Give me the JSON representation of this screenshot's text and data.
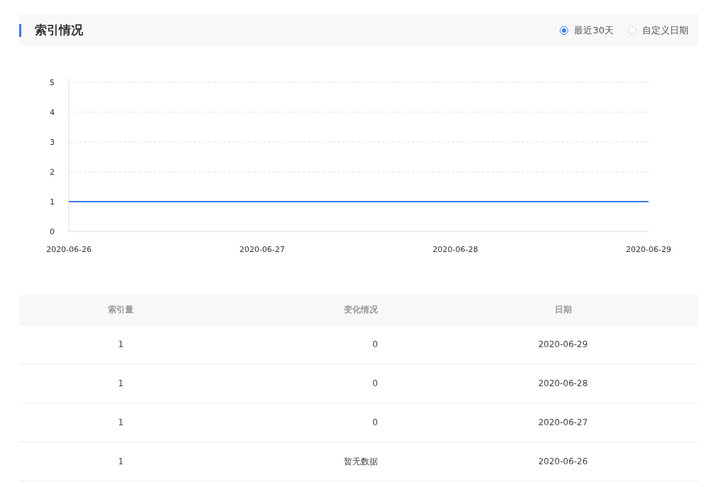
{
  "header": {
    "title": "索引情况",
    "range_options": [
      {
        "label": "最近30天",
        "selected": true
      },
      {
        "label": "自定义日期",
        "selected": false
      }
    ]
  },
  "chart_data": {
    "type": "line",
    "categories": [
      "2020-06-26",
      "2020-06-27",
      "2020-06-28",
      "2020-06-29"
    ],
    "ylim": [
      0,
      5
    ],
    "yticks": [
      0,
      1,
      2,
      3,
      4,
      5
    ],
    "grid": true,
    "series": [
      {
        "color": "#3a7bec",
        "values": [
          1,
          1,
          1,
          1
        ]
      }
    ]
  },
  "table": {
    "columns": [
      "索引量",
      "变化情况",
      "日期"
    ],
    "rows": [
      {
        "cells": [
          "1",
          "0",
          "2020-06-29"
        ]
      },
      {
        "cells": [
          "1",
          "0",
          "2020-06-28"
        ]
      },
      {
        "cells": [
          "1",
          "0",
          "2020-06-27"
        ]
      },
      {
        "cells": [
          "1",
          "暂无数据",
          "2020-06-26"
        ]
      }
    ]
  }
}
